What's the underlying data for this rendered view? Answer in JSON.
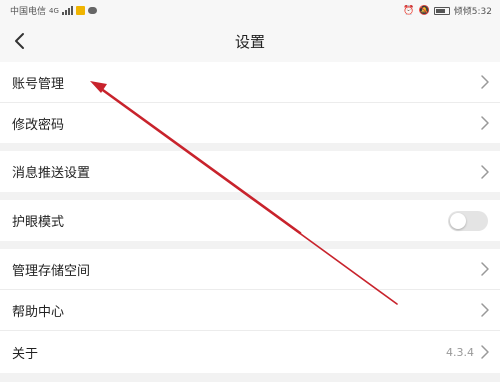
{
  "status_bar": {
    "carrier": "中国电信",
    "network": "4G",
    "right_text": "倾倾5:32"
  },
  "nav": {
    "title": "设置"
  },
  "settings": {
    "account": "账号管理",
    "password": "修改密码",
    "push": "消息推送设置",
    "eye_mode": "护眼模式",
    "storage": "管理存储空间",
    "help": "帮助中心",
    "about": "关于",
    "version": "4.3.4"
  },
  "toggles": {
    "eye_mode_on": false
  },
  "colors": {
    "background": "#f2f2f2",
    "row": "#ffffff",
    "annotation_arrow": "#c8232c",
    "chevron": "#999999"
  }
}
